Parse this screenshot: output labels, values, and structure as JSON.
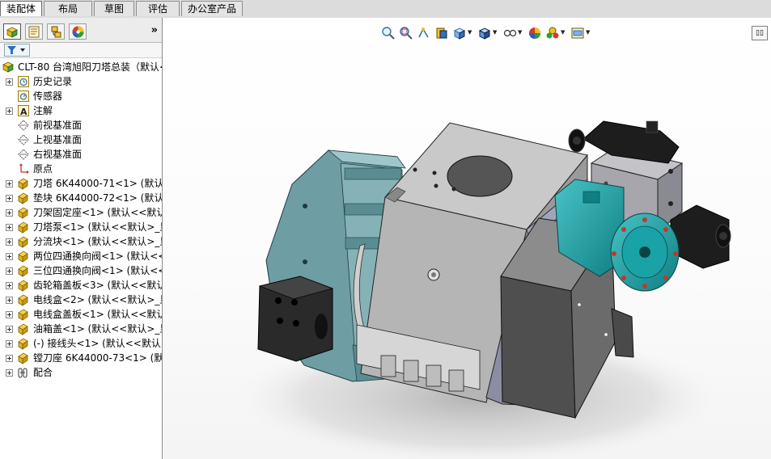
{
  "tabs": [
    {
      "label": "装配体",
      "active": true
    },
    {
      "label": "布局"
    },
    {
      "label": "草图"
    },
    {
      "label": "评估"
    },
    {
      "label": "办公室产品"
    }
  ],
  "panel": {
    "tabs": [
      {
        "name": "featuremanager-tab",
        "icon": "assembly-tree-icon"
      },
      {
        "name": "propertymanager-tab",
        "icon": "property-manager-icon"
      },
      {
        "name": "configurationmanager-tab",
        "icon": "configuration-manager-icon"
      },
      {
        "name": "appearance-tab",
        "icon": "appearance-wheel-icon"
      }
    ],
    "expand_label": "»",
    "filter_icon": "funnel-filter-icon",
    "root": {
      "label": "CLT-80 台湾旭阳刀塔总装（默认<",
      "icon": "assembly-icon"
    },
    "items": [
      {
        "label": "历史记录",
        "icon": "history-icon",
        "expandable": true
      },
      {
        "label": "传感器",
        "icon": "sensor-icon",
        "expandable": false
      },
      {
        "label": "注解",
        "icon": "annotation-icon",
        "expandable": true
      },
      {
        "label": "前视基准面",
        "icon": "plane-icon",
        "expandable": false
      },
      {
        "label": "上视基准面",
        "icon": "plane-icon",
        "expandable": false
      },
      {
        "label": "右视基准面",
        "icon": "plane-icon",
        "expandable": false
      },
      {
        "label": "原点",
        "icon": "origin-icon",
        "expandable": false
      },
      {
        "label": "刀塔 6K44000-71<1> (默认-",
        "icon": "part-icon",
        "expandable": true
      },
      {
        "label": "垫块 6K44000-72<1> (默认-",
        "icon": "part-icon",
        "expandable": true
      },
      {
        "label": "刀架固定座<1> (默认<<默认",
        "icon": "part-icon",
        "expandable": true
      },
      {
        "label": "刀塔泵<1> (默认<<默认>_显",
        "icon": "part-icon",
        "expandable": true
      },
      {
        "label": "分流块<1> (默认<<默认>_显",
        "icon": "part-icon",
        "expandable": true
      },
      {
        "label": "两位四通换向阀<1> (默认<<",
        "icon": "part-icon",
        "expandable": true
      },
      {
        "label": "三位四通换向阀<1> (默认<<",
        "icon": "part-icon",
        "expandable": true
      },
      {
        "label": "齿轮箱盖板<3> (默认<<默认",
        "icon": "part-icon",
        "expandable": true
      },
      {
        "label": "电线盒<2> (默认<<默认>_显",
        "icon": "part-icon",
        "expandable": true
      },
      {
        "label": "电线盒盖板<1> (默认<<默认",
        "icon": "part-icon",
        "expandable": true
      },
      {
        "label": "油箱盖<1> (默认<<默认>_显",
        "icon": "part-icon",
        "expandable": true
      },
      {
        "label": "(-) 接线头<1> (默认<<默认>",
        "icon": "part-icon",
        "expandable": true
      },
      {
        "label": "镗刀座 6K44000-73<1> (默认",
        "icon": "part-icon",
        "expandable": true
      },
      {
        "label": "配合",
        "icon": "mates-icon",
        "expandable": true
      }
    ]
  },
  "view_toolbar": [
    {
      "name": "zoom-to-fit-icon"
    },
    {
      "name": "zoom-to-area-icon"
    },
    {
      "name": "previous-view-icon"
    },
    {
      "name": "section-view-icon"
    },
    {
      "name": "view-orientation-icon",
      "dropdown": true
    },
    {
      "name": "display-style-icon",
      "dropdown": true
    },
    {
      "name": "hide-show-items-icon",
      "dropdown": true
    },
    {
      "name": "edit-appearance-icon"
    },
    {
      "name": "apply-scene-icon",
      "dropdown": true
    },
    {
      "name": "view-settings-icon",
      "dropdown": true
    }
  ],
  "colors": {
    "teal": "#1aa3a6",
    "grey_body": "#b3b3b3",
    "dark_box": "#5b5b5b",
    "accent_blue": "#2f6fbf"
  }
}
